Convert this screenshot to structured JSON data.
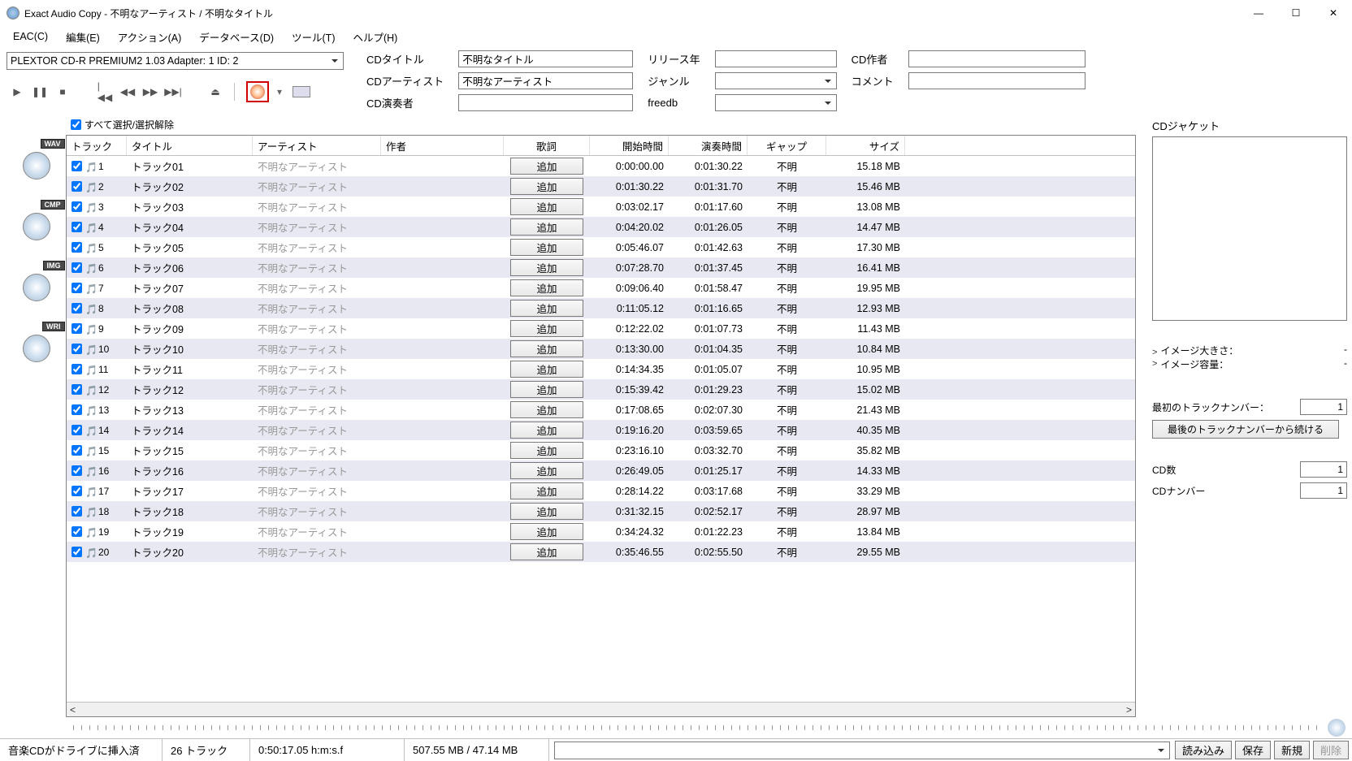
{
  "titlebar": {
    "app": "Exact Audio Copy",
    "sep": "   -   ",
    "subtitle": "不明なアーティスト / 不明なタイトル"
  },
  "menu": {
    "eac": "EAC(C)",
    "edit": "編集(E)",
    "action": "アクション(A)",
    "db": "データベース(D)",
    "tools": "ツール(T)",
    "help": "ヘルプ(H)"
  },
  "drive": "PLEXTOR CD-R   PREMIUM2 1.03   Adapter: 1  ID: 2",
  "meta": {
    "title_lbl": "CDタイトル",
    "title": "不明なタイトル",
    "artist_lbl": "CDアーティスト",
    "artist": "不明なアーティスト",
    "performer_lbl": "CD演奏者",
    "performer": "",
    "year_lbl": "リリース年",
    "year": "",
    "genre_lbl": "ジャンル",
    "genre": "",
    "freedb_lbl": "freedb",
    "freedb": "",
    "composer_lbl": "CD作者",
    "composer": "",
    "comment_lbl": "コメント",
    "comment": ""
  },
  "selectall": "すべて選択/選択解除",
  "headers": {
    "track": "トラック",
    "title": "タイトル",
    "artist": "アーティスト",
    "composer": "作者",
    "lyric": "歌詞",
    "start": "開始時間",
    "play": "演奏時間",
    "gap": "ギャップ",
    "size": "サイズ"
  },
  "lyric_btn": "追加",
  "tracks": [
    {
      "n": "1",
      "title": "トラック01",
      "artist": "不明なアーティスト",
      "start": "0:00:00.00",
      "play": "0:01:30.22",
      "gap": "不明",
      "size": "15.18 MB"
    },
    {
      "n": "2",
      "title": "トラック02",
      "artist": "不明なアーティスト",
      "start": "0:01:30.22",
      "play": "0:01:31.70",
      "gap": "不明",
      "size": "15.46 MB"
    },
    {
      "n": "3",
      "title": "トラック03",
      "artist": "不明なアーティスト",
      "start": "0:03:02.17",
      "play": "0:01:17.60",
      "gap": "不明",
      "size": "13.08 MB"
    },
    {
      "n": "4",
      "title": "トラック04",
      "artist": "不明なアーティスト",
      "start": "0:04:20.02",
      "play": "0:01:26.05",
      "gap": "不明",
      "size": "14.47 MB"
    },
    {
      "n": "5",
      "title": "トラック05",
      "artist": "不明なアーティスト",
      "start": "0:05:46.07",
      "play": "0:01:42.63",
      "gap": "不明",
      "size": "17.30 MB"
    },
    {
      "n": "6",
      "title": "トラック06",
      "artist": "不明なアーティスト",
      "start": "0:07:28.70",
      "play": "0:01:37.45",
      "gap": "不明",
      "size": "16.41 MB"
    },
    {
      "n": "7",
      "title": "トラック07",
      "artist": "不明なアーティスト",
      "start": "0:09:06.40",
      "play": "0:01:58.47",
      "gap": "不明",
      "size": "19.95 MB"
    },
    {
      "n": "8",
      "title": "トラック08",
      "artist": "不明なアーティスト",
      "start": "0:11:05.12",
      "play": "0:01:16.65",
      "gap": "不明",
      "size": "12.93 MB"
    },
    {
      "n": "9",
      "title": "トラック09",
      "artist": "不明なアーティスト",
      "start": "0:12:22.02",
      "play": "0:01:07.73",
      "gap": "不明",
      "size": "11.43 MB"
    },
    {
      "n": "10",
      "title": "トラック10",
      "artist": "不明なアーティスト",
      "start": "0:13:30.00",
      "play": "0:01:04.35",
      "gap": "不明",
      "size": "10.84 MB"
    },
    {
      "n": "11",
      "title": "トラック11",
      "artist": "不明なアーティスト",
      "start": "0:14:34.35",
      "play": "0:01:05.07",
      "gap": "不明",
      "size": "10.95 MB"
    },
    {
      "n": "12",
      "title": "トラック12",
      "artist": "不明なアーティスト",
      "start": "0:15:39.42",
      "play": "0:01:29.23",
      "gap": "不明",
      "size": "15.02 MB"
    },
    {
      "n": "13",
      "title": "トラック13",
      "artist": "不明なアーティスト",
      "start": "0:17:08.65",
      "play": "0:02:07.30",
      "gap": "不明",
      "size": "21.43 MB"
    },
    {
      "n": "14",
      "title": "トラック14",
      "artist": "不明なアーティスト",
      "start": "0:19:16.20",
      "play": "0:03:59.65",
      "gap": "不明",
      "size": "40.35 MB"
    },
    {
      "n": "15",
      "title": "トラック15",
      "artist": "不明なアーティスト",
      "start": "0:23:16.10",
      "play": "0:03:32.70",
      "gap": "不明",
      "size": "35.82 MB"
    },
    {
      "n": "16",
      "title": "トラック16",
      "artist": "不明なアーティスト",
      "start": "0:26:49.05",
      "play": "0:01:25.17",
      "gap": "不明",
      "size": "14.33 MB"
    },
    {
      "n": "17",
      "title": "トラック17",
      "artist": "不明なアーティスト",
      "start": "0:28:14.22",
      "play": "0:03:17.68",
      "gap": "不明",
      "size": "33.29 MB"
    },
    {
      "n": "18",
      "title": "トラック18",
      "artist": "不明なアーティスト",
      "start": "0:31:32.15",
      "play": "0:02:52.17",
      "gap": "不明",
      "size": "28.97 MB"
    },
    {
      "n": "19",
      "title": "トラック19",
      "artist": "不明なアーティスト",
      "start": "0:34:24.32",
      "play": "0:01:22.23",
      "gap": "不明",
      "size": "13.84 MB"
    },
    {
      "n": "20",
      "title": "トラック20",
      "artist": "不明なアーティスト",
      "start": "0:35:46.55",
      "play": "0:02:55.50",
      "gap": "不明",
      "size": "29.55 MB"
    }
  ],
  "rightpanel": {
    "cdjacket": "CDジャケット",
    "img_size": "イメージ大きさ：",
    "img_size_v": "-",
    "img_cap": "イメージ容量：",
    "img_cap_v": "-",
    "first_track": "最初のトラックナンバー：",
    "first_track_v": "1",
    "continue_btn": "最後のトラックナンバーから続ける",
    "cd_count": "CD数",
    "cd_count_v": "1",
    "cd_num": "CDナンバー",
    "cd_num_v": "1"
  },
  "status": {
    "drive": "音楽CDがドライブに挿入済",
    "tracks": "26 トラック",
    "time": "0:50:17.05 h:m:s.f",
    "size": "507.55 MB  /  47.14 MB",
    "load": "読み込み",
    "save": "保存",
    "new": "新規",
    "delete": "削除"
  }
}
